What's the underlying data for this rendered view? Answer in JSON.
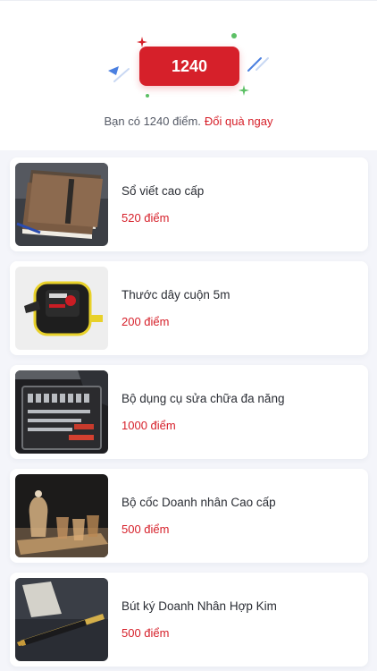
{
  "header": {
    "points_value": "1240",
    "summary_prefix": "Bạn có 1240 điểm.",
    "redeem_link": "Đổi quà ngay"
  },
  "gifts": [
    {
      "name": "Sổ viết cao cấp",
      "price": "520 điểm",
      "image_icon": "notebook-image"
    },
    {
      "name": "Thước dây cuộn 5m",
      "price": "200 điểm",
      "image_icon": "tape-measure-image"
    },
    {
      "name": "Bộ dụng cụ sửa chữa đa năng",
      "price": "1000 điểm",
      "image_icon": "toolkit-image"
    },
    {
      "name": "Bộ cốc Doanh nhân Cao cấp",
      "price": "500 điểm",
      "image_icon": "glass-set-image"
    },
    {
      "name": "Bút ký Doanh Nhân Hợp Kim",
      "price": "500 điểm",
      "image_icon": "pen-image"
    }
  ],
  "colors": {
    "accent": "#d6202a",
    "background": "#f4f5fa",
    "card": "#ffffff"
  }
}
